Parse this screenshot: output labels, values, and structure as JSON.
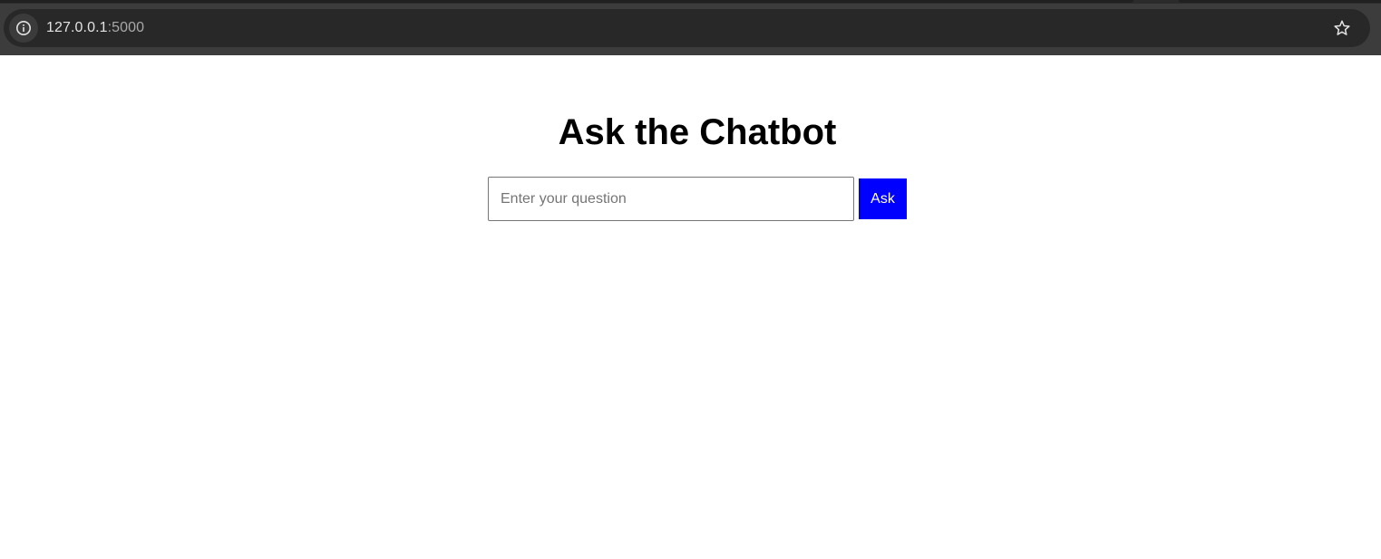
{
  "browser": {
    "url_host": "127.0.0.1",
    "url_port": ":5000",
    "site_info_icon": "info-icon",
    "bookmark_icon": "star-outline-icon"
  },
  "page": {
    "title": "Ask the Chatbot",
    "question_input": {
      "value": "",
      "placeholder": "Enter your question"
    },
    "ask_button_label": "Ask",
    "colors": {
      "ask_button_background": "#0000ff",
      "ask_button_text": "#ffffff",
      "title_text": "#000000"
    }
  }
}
